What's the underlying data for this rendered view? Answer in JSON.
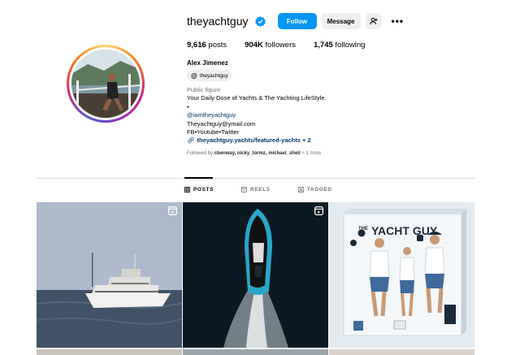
{
  "profile": {
    "username": "theyachtguy",
    "follow_label": "Follow",
    "message_label": "Message",
    "posts_count": "9,616",
    "posts_label": "posts",
    "followers_count": "904K",
    "followers_label": "followers",
    "following_count": "1,745",
    "following_label": "following",
    "full_name": "Alex Jimenez",
    "threads_handle": "theyachtguy",
    "category": "Public figure",
    "bio_lines": [
      "Your Daily Dose of Yachts & The Yachting LifeStyle.",
      "•",
      "@iamtheyachtguy",
      "Theyachtguy@ymail.com",
      "FB•Youtube•Twitter"
    ],
    "link_text": "theyachtguy.yachts/featured-yachts + 2",
    "followed_by_prefix": "Followed by ",
    "followed_by_names": "cbenway, nicky_tormz, michael_sheil",
    "followed_by_suffix": " + 1 more"
  },
  "tabs": [
    {
      "label": "POSTS",
      "icon": "grid-icon",
      "active": true
    },
    {
      "label": "REELS",
      "icon": "reels-icon",
      "active": false
    },
    {
      "label": "TAGGED",
      "icon": "tagged-icon",
      "active": false
    }
  ],
  "posts": [
    {
      "type": "reel",
      "subject": "superyacht-at-sea"
    },
    {
      "type": "reel",
      "subject": "speedboat-aerial"
    },
    {
      "type": "image",
      "subject": "yacht-guy-poster",
      "poster_title": "YACHT GUY",
      "poster_prefix": "THE"
    }
  ],
  "colors": {
    "accent": "#0095f6",
    "secondary_button": "#efefef",
    "link": "#00376b",
    "muted_text": "#737373"
  }
}
